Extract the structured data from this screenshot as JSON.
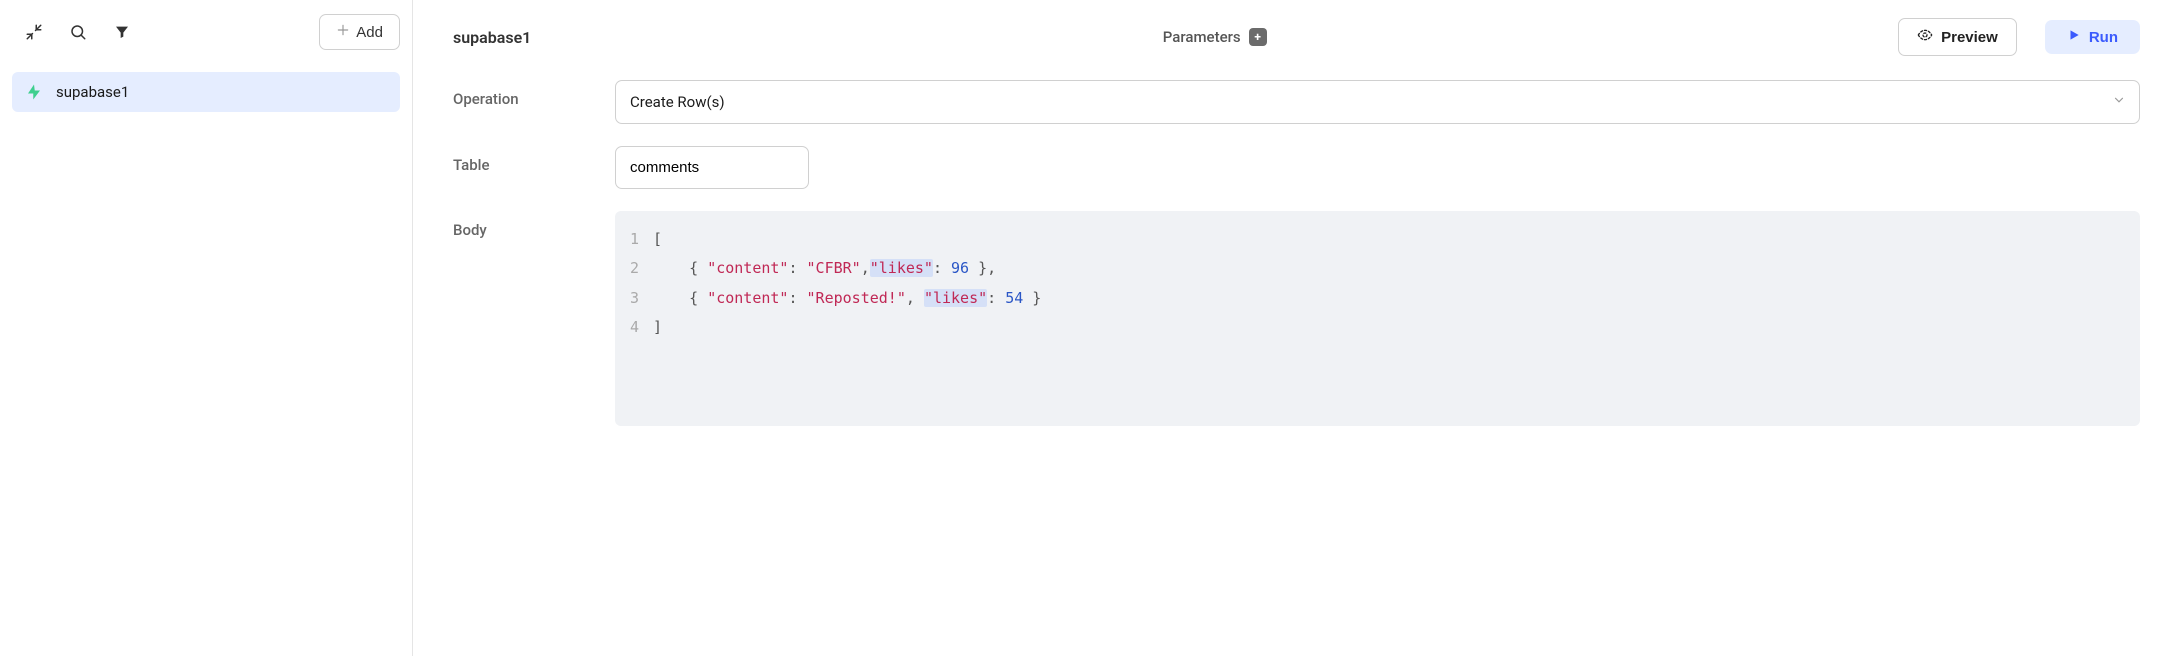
{
  "sidebar": {
    "add_label": "Add",
    "items": [
      {
        "label": "supabase1"
      }
    ]
  },
  "header": {
    "query_name": "supabase1",
    "parameters_label": "Parameters",
    "preview_label": "Preview",
    "run_label": "Run"
  },
  "form": {
    "operation_label": "Operation",
    "operation_value": "Create Row(s)",
    "table_label": "Table",
    "table_value": "comments",
    "body_label": "Body",
    "body_code": {
      "line1": "[",
      "line2_brace_open": "    { ",
      "line2_content_key": "\"content\"",
      "line2_colon1": ": ",
      "line2_content_val": "\"CFBR\"",
      "line2_comma": ",",
      "line2_likes_key": "\"likes\"",
      "line2_colon2": ": ",
      "line2_likes_val": "96",
      "line2_brace_close": " },",
      "line3_brace_open": "    { ",
      "line3_content_key": "\"content\"",
      "line3_colon1": ": ",
      "line3_content_val": "\"Reposted!\"",
      "line3_comma": ", ",
      "line3_likes_key": "\"likes\"",
      "line3_colon2": ": ",
      "line3_likes_val": "54",
      "line3_brace_close": " }",
      "line4": "]"
    }
  }
}
